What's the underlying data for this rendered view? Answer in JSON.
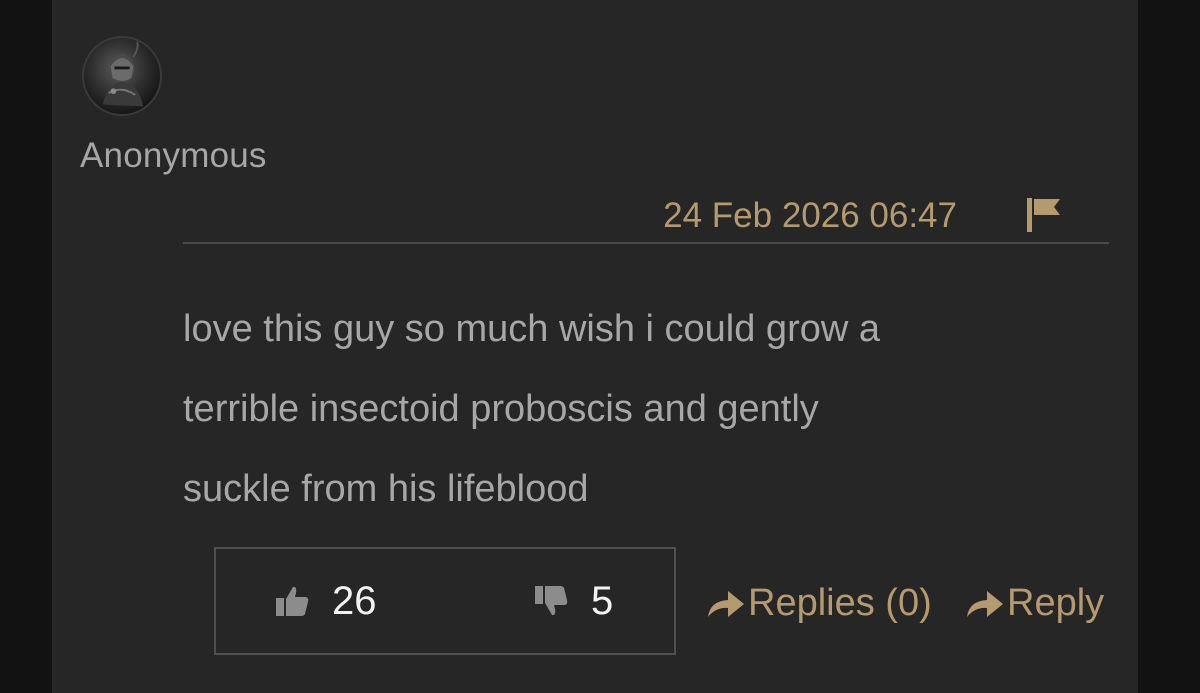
{
  "comment": {
    "author": "Anonymous",
    "timestamp": "24 Feb 2026 06:47",
    "body_lines": [
      "love this guy so much wish i could grow a",
      "terrible insectoid proboscis and gently",
      "suckle from his lifeblood"
    ],
    "likes": "26",
    "dislikes": "5",
    "replies_label": "Replies (0)",
    "reply_label": "Reply"
  },
  "colors": {
    "page_bg": "#121212",
    "card_bg": "#262626",
    "accent": "#b49a6e",
    "text": "#a7a7a7",
    "count_text": "#f2f2f2"
  },
  "icons": {
    "avatar": "armored-knight-avatar",
    "report": "flag-icon",
    "like": "thumbs-up-icon",
    "dislike": "thumbs-down-icon",
    "reply": "reply-arrow-icon"
  }
}
